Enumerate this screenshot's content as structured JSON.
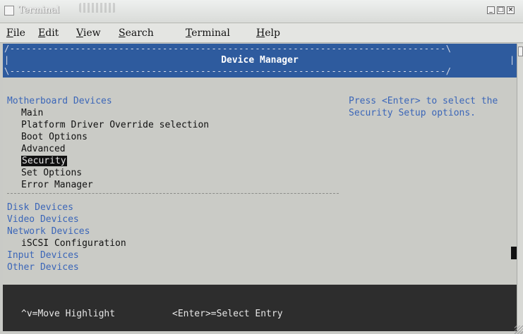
{
  "window": {
    "title": "Terminal",
    "buttons": [
      "minimize",
      "maximize",
      "close"
    ]
  },
  "menubar": {
    "items": [
      {
        "hot": "F",
        "rest": "ile"
      },
      {
        "hot": "E",
        "rest": "dit"
      },
      {
        "hot": "V",
        "rest": "iew"
      },
      {
        "hot": "S",
        "rest": "earch"
      },
      {
        "hot": "T",
        "rest": "erminal"
      },
      {
        "hot": "H",
        "rest": "elp"
      }
    ]
  },
  "screen": {
    "title": "Device Manager",
    "border_top": "/--------------------------------------------------------------------------------\\",
    "border_side": "|",
    "border_bottom": "\\--------------------------------------------------------------------------------/",
    "categories": {
      "motherboard": "Motherboard Devices",
      "disk": "Disk Devices",
      "video": "Video Devices",
      "network": "Network Devices",
      "input": "Input Devices",
      "other": "Other Devices"
    },
    "motherboard_items": [
      "Main",
      "Platform Driver Override selection",
      "Boot Options",
      "Advanced",
      "Security",
      "Set Options",
      "Error Manager"
    ],
    "selected_item": "Security",
    "network_items": [
      "iSCSI Configuration"
    ],
    "help_text": "Press <Enter> to select the Security Setup options.",
    "footer": {
      "move_hint": "^v=Move Highlight",
      "select_hint": "<Enter>=Select Entry"
    }
  },
  "colors": {
    "header_bg": "#2e5b9e",
    "category_text": "#3b66b8",
    "footer_bg": "#2d2d2d",
    "terminal_bg": "#cacbc6"
  }
}
